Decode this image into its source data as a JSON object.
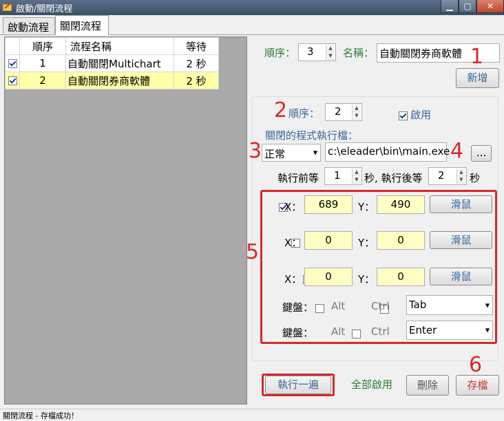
{
  "window": {
    "title": "啟動/關閉流程"
  },
  "tabs": [
    {
      "label": "啟動流程"
    },
    {
      "label": "關閉流程"
    }
  ],
  "grid": {
    "headers": {
      "order": "順序",
      "name": "流程名稱",
      "wait": "等待"
    },
    "rows": [
      {
        "checked": true,
        "order": "1",
        "name": "自動關閉Multichart",
        "wait": "2 秒"
      },
      {
        "checked": true,
        "order": "2",
        "name": "自動關閉券商軟體",
        "wait": "2 秒"
      }
    ]
  },
  "top_form": {
    "order_label": "順序：",
    "order_value": "3",
    "name_label": "名稱：",
    "name_value": "自動關閉券商軟體",
    "add_button": "新增"
  },
  "detail": {
    "order_label": "順序：",
    "order_value": "2",
    "enable_label": "啟用",
    "enable_checked": true,
    "exe_label": "關閉的程式執行檔：",
    "window_mode": "正常",
    "exe_path": "c:\\eleader\\bin\\main.exe",
    "browse_button": "...",
    "wait_before_label": "執行前等",
    "wait_before_value": "1",
    "wait_mid_label": "秒, 執行後等",
    "wait_after_value": "2",
    "wait_after_unit": "秒",
    "mouse_rows": [
      {
        "checked": true,
        "x_label": "X：",
        "x": "689",
        "y_label": "Y：",
        "y": "490",
        "button": "滑鼠"
      },
      {
        "checked": false,
        "x_label": "X：",
        "x": "0",
        "y_label": "Y：",
        "y": "0",
        "button": "滑鼠"
      },
      {
        "checked": false,
        "x_label": "X：",
        "x": "0",
        "y_label": "Y：",
        "y": "0",
        "button": "滑鼠"
      }
    ],
    "key_rows": [
      {
        "label": "鍵盤：",
        "alt": "Alt",
        "ctrl": "Ctrl",
        "key": "Tab"
      },
      {
        "label": "鍵盤：",
        "alt": "Alt",
        "ctrl": "Ctrl",
        "key": "Enter"
      }
    ]
  },
  "bottom": {
    "run_button": "執行一遍",
    "enable_all_label": "全部啟用",
    "delete_button": "刪除",
    "save_button": "存檔"
  },
  "annotations": [
    "1",
    "2",
    "3",
    "4",
    "5",
    "6"
  ],
  "status": {
    "text": "關閉流程 - 存檔成功！"
  },
  "colors": {
    "annotation_red": "#d42a2a",
    "highlight_yellow": "#ffffa8",
    "label_blue": "#37699e",
    "label_green": "#2e7d32"
  }
}
